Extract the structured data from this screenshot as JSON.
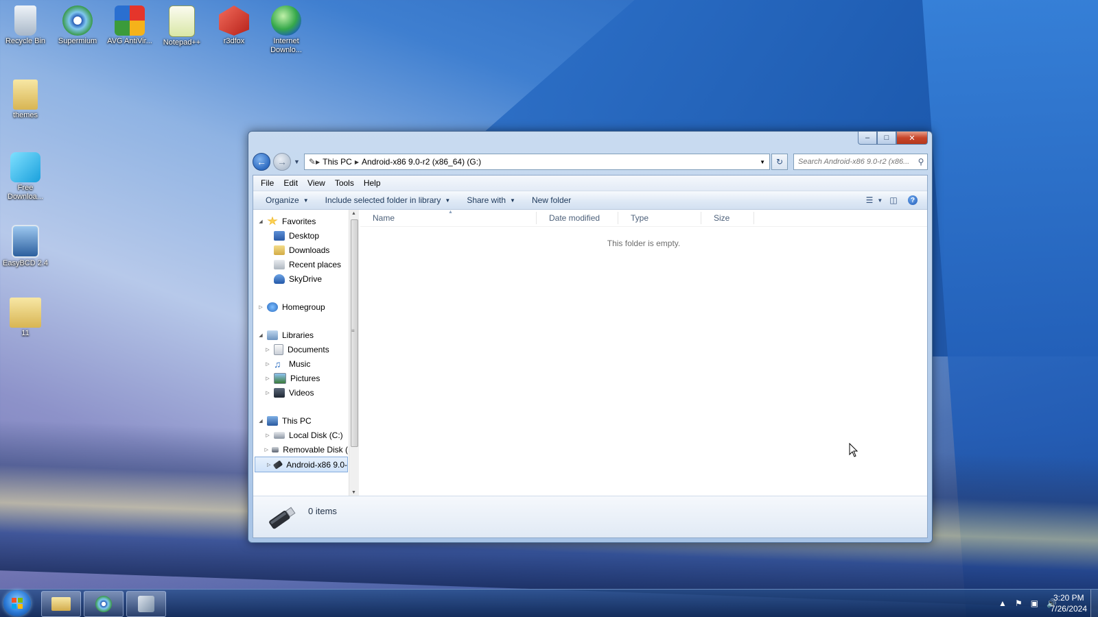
{
  "desktop": {
    "icons": [
      {
        "label": "Recycle Bin",
        "icon": "recycle-bin-icon"
      },
      {
        "label": "Supermium",
        "icon": "browser-icon"
      },
      {
        "label": "AVG AntiVir...",
        "icon": "antivirus-icon"
      },
      {
        "label": "Notepad++",
        "icon": "notepad-icon"
      },
      {
        "label": "r3dfox",
        "icon": "fox-browser-icon"
      },
      {
        "label": "Internet Downlo...",
        "icon": "download-manager-icon"
      },
      {
        "label": "themes",
        "icon": "folder-icon"
      },
      {
        "label": "Free Downloa...",
        "icon": "free-download-icon"
      },
      {
        "label": "EasyBCD 2.4",
        "icon": "easybcd-icon"
      },
      {
        "label": "11",
        "icon": "folder-icon"
      }
    ]
  },
  "window": {
    "address": {
      "segments": [
        "This PC",
        "Android-x86 9.0-r2 (x86_64) (G:)"
      ]
    },
    "search": {
      "placeholder": "Search Android-x86 9.0-r2 (x86..."
    },
    "menu": [
      "File",
      "Edit",
      "View",
      "Tools",
      "Help"
    ],
    "commands": {
      "organize": "Organize",
      "include": "Include selected folder in library",
      "share": "Share with",
      "new_folder": "New folder"
    },
    "nav": {
      "favorites": "Favorites",
      "desktop": "Desktop",
      "downloads": "Downloads",
      "recent": "Recent places",
      "skydrive": "SkyDrive",
      "homegroup": "Homegroup",
      "libraries": "Libraries",
      "documents": "Documents",
      "music": "Music",
      "pictures": "Pictures",
      "videos": "Videos",
      "this_pc": "This PC",
      "local_disk": "Local Disk (C:)",
      "removable": "Removable Disk (",
      "android": "Android-x86 9.0-"
    },
    "columns": [
      "Name",
      "Date modified",
      "Type",
      "Size"
    ],
    "empty_text": "This folder is empty.",
    "status": "0 items"
  },
  "taskbar": {
    "time": "3:20 PM",
    "date": "7/26/2024"
  },
  "colors": {
    "accent": "#2f6cc2",
    "selection": "#cfe2f9"
  }
}
